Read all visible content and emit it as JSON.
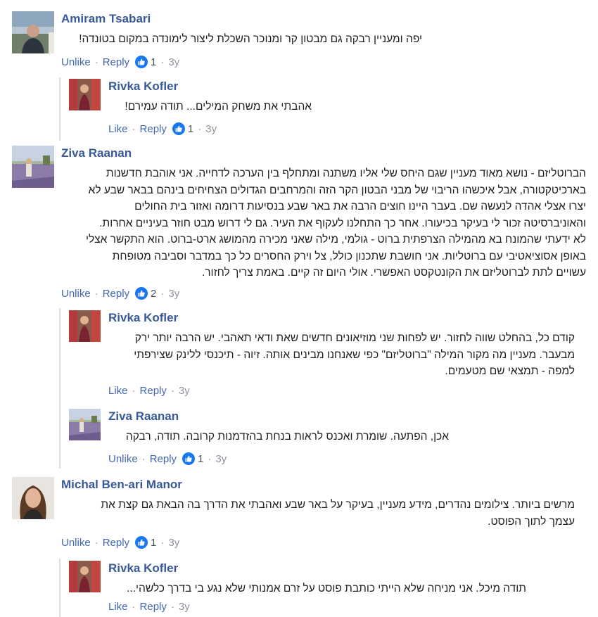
{
  "comments": [
    {
      "author": "Amiram Tsabari",
      "text": "יפה ומעניין רבקה גם מבטון קר ומנוכר השכלת ליצור לימונדה במקום בטונדה!",
      "unlike": "Unlike",
      "reply": "Reply",
      "likes": "1",
      "age": "3y"
    },
    {
      "author": "Rivka Kofler",
      "text": "אהבתי את משחק המילים... תודה עמירם!",
      "unlike": "Like",
      "reply": "Reply",
      "likes": "1",
      "age": "3y"
    },
    {
      "author": "Ziva Raanan",
      "text_lines": [
        "הברוטליזם - נושא מאוד מעניין שגם היחס שלי אליו משתנה ומתחלף בין הערכה לדחייה. אני אוהבת חדשנות",
        "בארכיטקטורה, אבל איכשהו הריבוי של מבני הבטון הקר הזה והמרחבים הגדולים הצחיחים בינהם בבאר שבע לא",
        "יצרו אצלי אהדה לנעשה שם. בעבר היינו חוצים הרבה את באר שבע בנסיעות דרומה ואזור בית החולים",
        "והאוניברסיטה זכור לי בעיקר בכיעורו. אחר כך התחלנו לעקוף את העיר. גם לי דרוש מבט חוזר בעיניים אחרות.",
        "לא ידעתי שהמונח בא מהמילה הצרפתית ברוט - גולמי, מילה שאני מכירה מהמושג ארט-ברוט. הוא התקשר אצלי",
        "באופן אסוציאטיבי עם ברוטליות. אני חושבת שתכנון כולל, צל וירק החסרים כל כך במדבר וסביבה מטופחת",
        "עשויים לתת לברוטליזם את הקונטקסט האפשרי. אולי היום זה קיים. באמת צריך לחזור."
      ],
      "unlike": "Unlike",
      "reply": "Reply",
      "likes": "2",
      "age": "3y"
    },
    {
      "author": "Rivka Kofler",
      "text_lines": [
        "קודם כל, בהחלט שווה לחזור. יש לפחות שני מוזיאונים חדשים שאת ודאי תאהבי. יש הרבה יותר ירק",
        "מבעבר. מעניין מה מקור המילה \"ברוטליזם\" כפי שאנחנו מבינים אותה. זיוה - תיכנסי ללינק שצירפתי",
        "למפה - תמצאי שם מטעמים."
      ],
      "like": "Like",
      "reply": "Reply",
      "age": "3y"
    },
    {
      "author": "Ziva Raanan",
      "text": "אכן, הפתעה. שומרת ואכנס לראות בנחת בהזדמנות קרובה. תודה, רבקה",
      "unlike": "Unlike",
      "reply": "Reply",
      "likes": "1",
      "age": "3y"
    },
    {
      "author": "Michal Ben-ari Manor",
      "text_lines": [
        "מרשים ביותר. צילומים נהדרים, מידע מעניין, בעיקר על באר שבע ואהבתי את הדרך בה הבאת גם קצת את",
        "עצמך לתוך הפוסט."
      ],
      "unlike": "Unlike",
      "reply": "Reply",
      "likes": "1",
      "age": "3y"
    },
    {
      "author": "Rivka Kofler",
      "text": "תודה מיכל. אני מניחה שלא הייתי כותבת פוסט על זרם אמנותי שלא נגע בי בדרך כלשהי...",
      "like": "Like",
      "reply": "Reply",
      "age": "3y"
    }
  ],
  "separator": "·",
  "colors": {
    "link": "#4267b2",
    "author": "#385898",
    "like_badge": "#1877f2",
    "muted": "#90949c"
  }
}
